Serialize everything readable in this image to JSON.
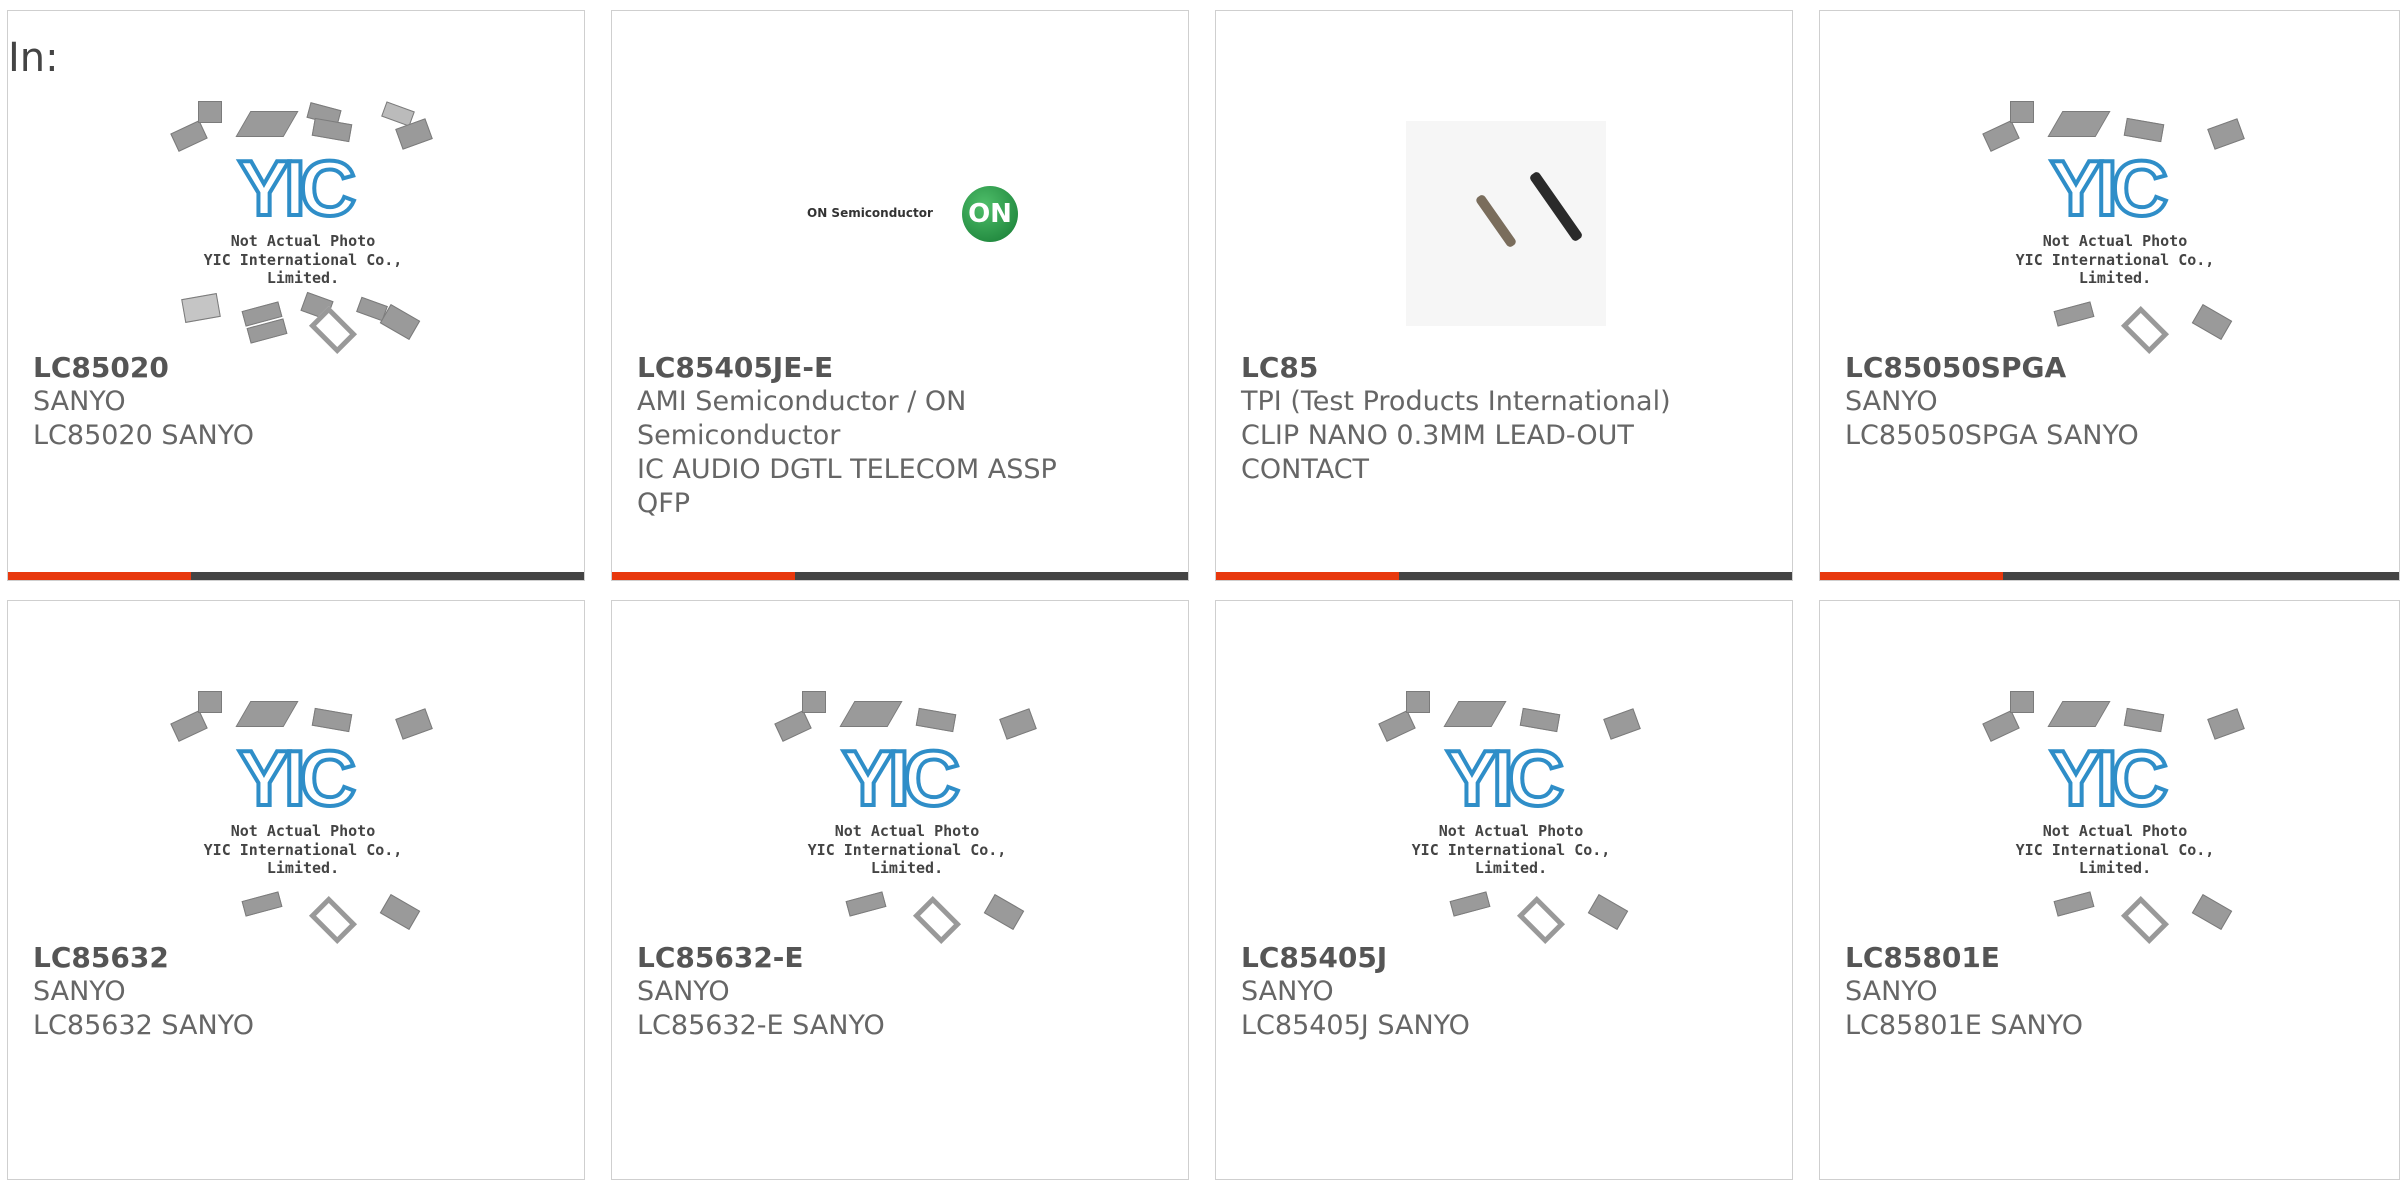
{
  "header": {
    "in_label": "In:"
  },
  "placeholder": {
    "line1": "Not Actual Photo",
    "line2": "YIC International Co., Limited."
  },
  "products": [
    {
      "part": "LC85020",
      "manufacturer": "SANYO",
      "desc_lines": [
        "LC85020 SANYO"
      ],
      "image": "yic-placeholder"
    },
    {
      "part": "LC85405JE-E",
      "manufacturer": "AMI Semiconductor / ON",
      "desc_lines": [
        "Semiconductor",
        "IC AUDIO DGTL TELECOM ASSP",
        "QFP"
      ],
      "image": "on-semiconductor-logo",
      "logo_text": "ON Semiconductor",
      "logo_mark": "ON"
    },
    {
      "part": "LC85",
      "manufacturer": "TPI (Test Products International)",
      "desc_lines": [
        "CLIP NANO 0.3MM LEAD-OUT",
        "CONTACT"
      ],
      "image": "product-photo"
    },
    {
      "part": "LC85050SPGA",
      "manufacturer": "SANYO",
      "desc_lines": [
        "LC85050SPGA SANYO"
      ],
      "image": "yic-placeholder"
    },
    {
      "part": "LC85632",
      "manufacturer": "SANYO",
      "desc_lines": [
        "LC85632 SANYO"
      ],
      "image": "yic-placeholder"
    },
    {
      "part": "LC85632-E",
      "manufacturer": "SANYO",
      "desc_lines": [
        "LC85632-E SANYO"
      ],
      "image": "yic-placeholder"
    },
    {
      "part": "LC85405J",
      "manufacturer": "SANYO",
      "desc_lines": [
        "LC85405J SANYO"
      ],
      "image": "yic-placeholder"
    },
    {
      "part": "LC85801E",
      "manufacturer": "SANYO",
      "desc_lines": [
        "LC85801E SANYO"
      ],
      "image": "yic-placeholder"
    }
  ],
  "colors": {
    "accent_bar": "#e8380d",
    "bar": "#444444",
    "yic_blue": "#2f8ec8"
  }
}
